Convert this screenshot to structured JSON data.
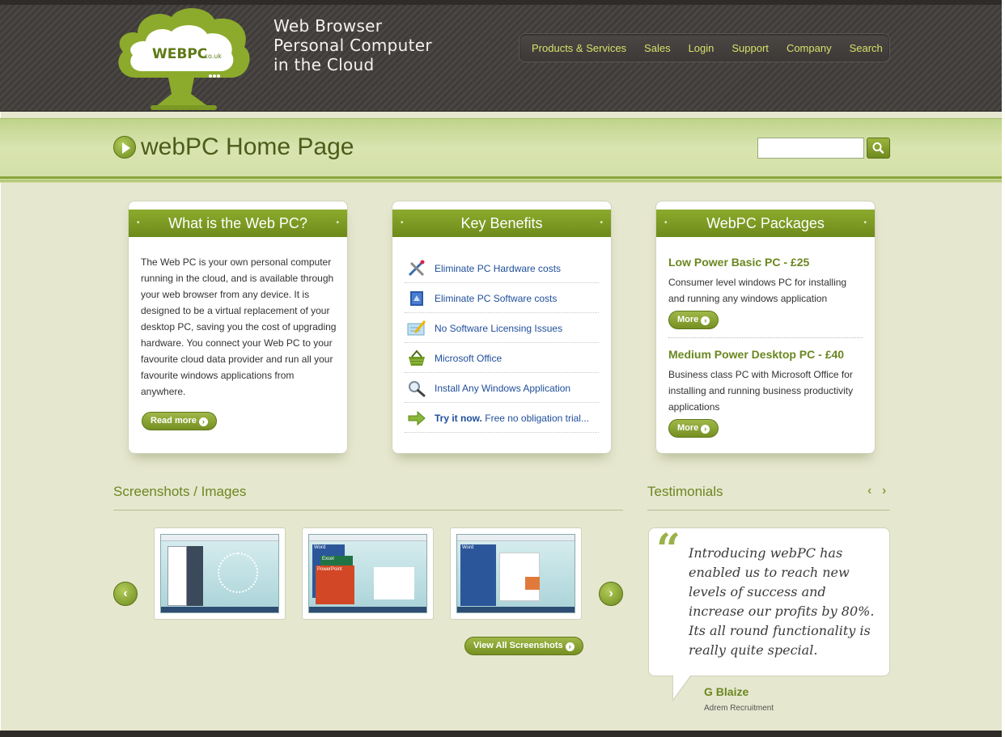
{
  "header": {
    "logo_text": "WEBPC",
    "logo_suffix": ".co.uk",
    "tagline": [
      "Web Browser",
      "Personal Computer",
      "in the Cloud"
    ],
    "nav": [
      "Products & Services",
      "Sales",
      "Login",
      "Support",
      "Company",
      "Search"
    ]
  },
  "titlebar": {
    "title": "webPC Home Page",
    "search_placeholder": ""
  },
  "boxes": {
    "what": {
      "heading": "What is the Web PC?",
      "text": "The Web PC is your own personal computer running in the cloud, and is available through your web browser from any device. It is designed to be a virtual replacement of your desktop PC, saving you the cost of upgrading hardware. You connect your Web PC to your favourite cloud data provider and run all your favourite windows applications from anywhere.",
      "button": "Read more"
    },
    "benefits": {
      "heading": "Key Benefits",
      "items": [
        {
          "label": "Eliminate PC Hardware costs",
          "icon": "tools-icon"
        },
        {
          "label": "Eliminate PC Software costs",
          "icon": "software-box-icon"
        },
        {
          "label": "No Software Licensing Issues",
          "icon": "license-pencil-icon"
        },
        {
          "label": "Microsoft Office",
          "icon": "basket-icon"
        },
        {
          "label": "Install Any Windows Application",
          "icon": "magnifier-icon"
        }
      ],
      "trial_bold": "Try it now.",
      "trial_rest": " Free no obligation trial..."
    },
    "packages": {
      "heading": "WebPC Packages",
      "items": [
        {
          "title": "Low Power Basic PC - £25",
          "desc": "Consumer level windows PC for installing and running any windows application",
          "button": "More"
        },
        {
          "title": "Medium Power Desktop PC - £40",
          "desc": "Business class PC with Microsoft Office for installing and running business productivity applications",
          "button": "More"
        }
      ]
    }
  },
  "screenshots": {
    "title": "Screenshots / Images",
    "view_all": "View All Screenshots",
    "thumbs": [
      {
        "alt": "Start menu screenshot",
        "labels": []
      },
      {
        "alt": "Office apps screenshot",
        "labels": [
          "Word",
          "Excel",
          "PowerPoint"
        ]
      },
      {
        "alt": "Word document screenshot",
        "labels": [
          "Word"
        ]
      }
    ]
  },
  "testimonials": {
    "title": "Testimonials",
    "prev": "‹",
    "next": "›",
    "quote": "Introducing webPC has enabled us to reach new levels of success and increase our profits by 80%. Its all round functionality is really quite special.",
    "author": "G Blaize",
    "company": "Adrem Recruitment"
  },
  "colors": {
    "accent_green": "#6d8a1b",
    "link_blue": "#1f4e9a",
    "nav_text": "#d7e26a",
    "header_dark": "#45413e"
  }
}
